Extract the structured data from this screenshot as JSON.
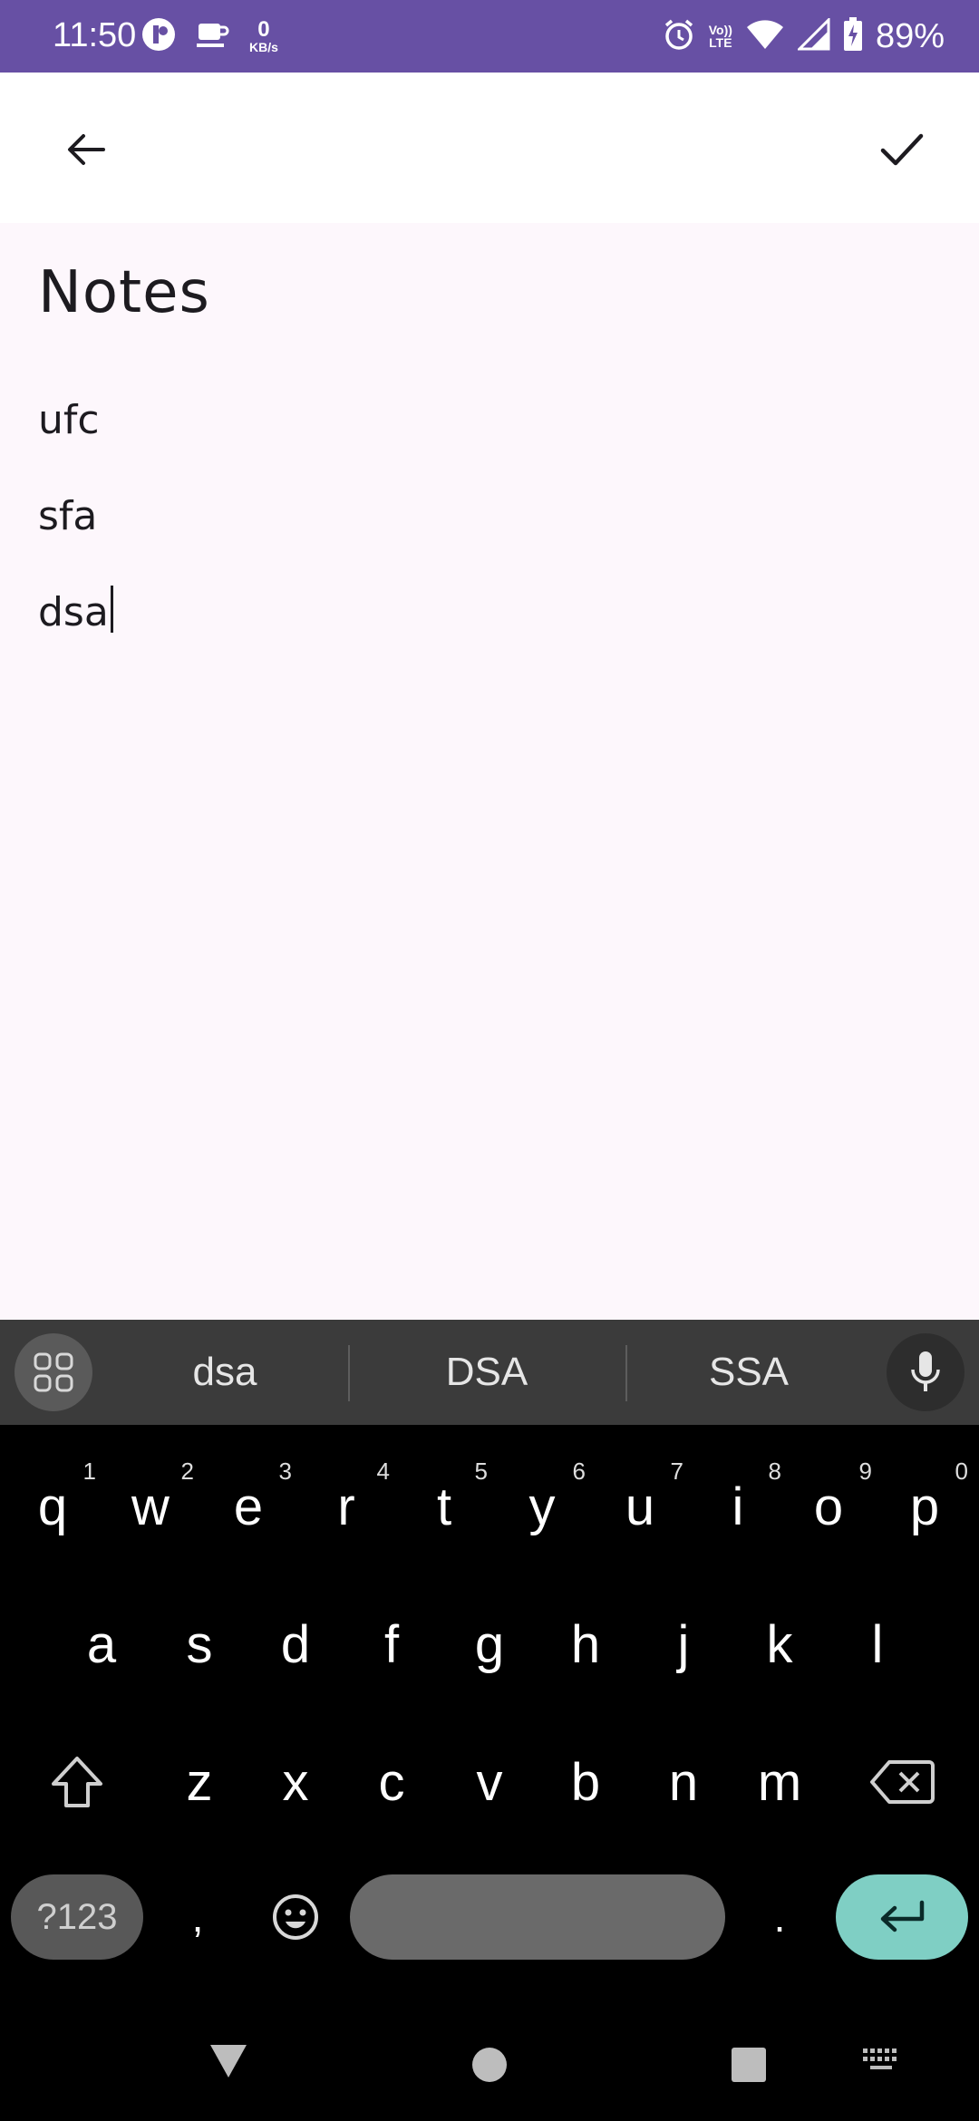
{
  "status_bar": {
    "time": "11:50",
    "net_speed_value": "0",
    "net_speed_unit": "KB/s",
    "volte_line1": "Vo))",
    "volte_line2": "LTE",
    "battery": "89%",
    "icons": [
      "app-icon",
      "coffee-icon",
      "alarm-icon",
      "volte-icon",
      "wifi-icon",
      "signal-icon",
      "battery-charging-icon"
    ]
  },
  "app_bar": {
    "back_icon": "arrow-left-icon",
    "done_icon": "check-icon"
  },
  "note": {
    "title": "Notes",
    "lines": [
      "ufc",
      "sfa",
      "dsa"
    ]
  },
  "keyboard": {
    "suggestions": [
      "dsa",
      "DSA",
      "SSA"
    ],
    "row1": [
      "q",
      "w",
      "e",
      "r",
      "t",
      "y",
      "u",
      "i",
      "o",
      "p"
    ],
    "row1_hints": [
      "1",
      "2",
      "3",
      "4",
      "5",
      "6",
      "7",
      "8",
      "9",
      "0"
    ],
    "row2": [
      "a",
      "s",
      "d",
      "f",
      "g",
      "h",
      "j",
      "k",
      "l"
    ],
    "row3": [
      "z",
      "x",
      "c",
      "v",
      "b",
      "n",
      "m"
    ],
    "symbols_label": "?123",
    "comma": ",",
    "period": ".",
    "accent_color": "#7fcfc4"
  },
  "nav_bar": {
    "icons": [
      "back-triangle-icon",
      "home-circle-icon",
      "recents-square-icon",
      "keyboard-icon"
    ]
  }
}
